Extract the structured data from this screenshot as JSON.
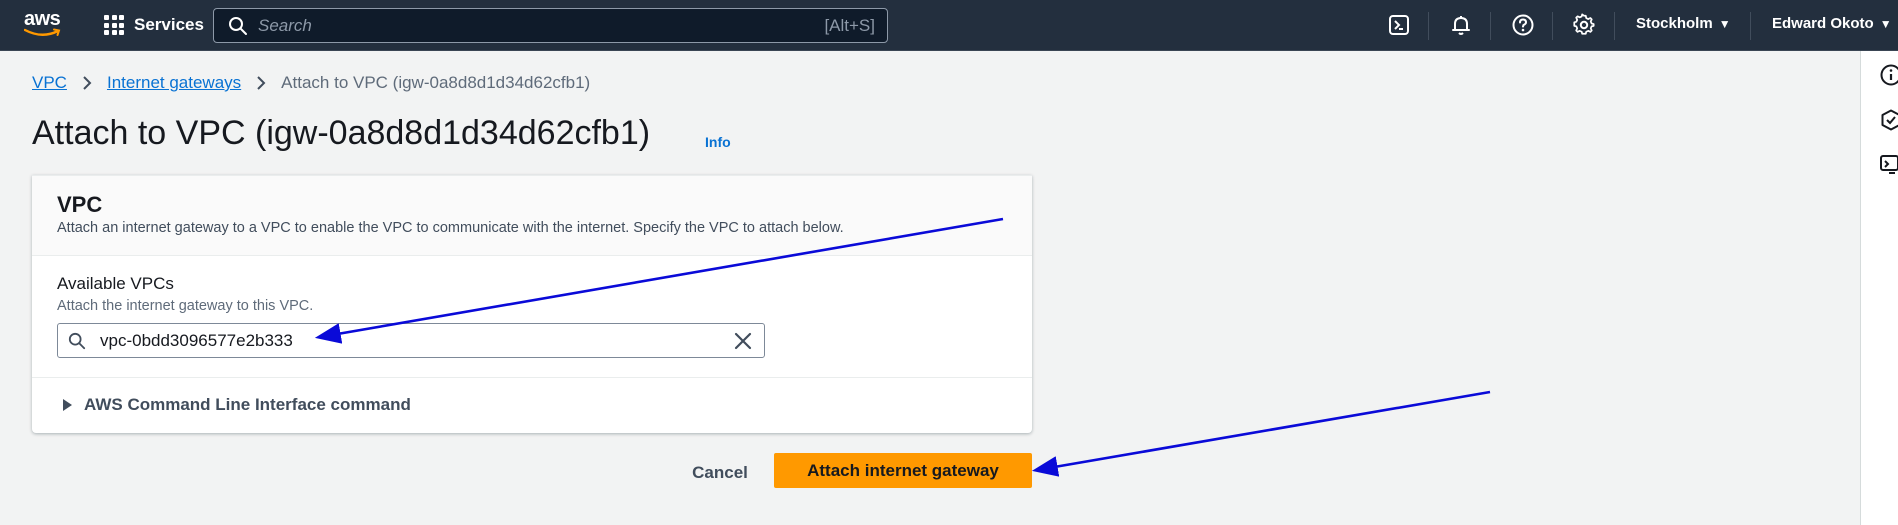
{
  "topnav": {
    "logo_text": "aws",
    "services_label": "Services",
    "search_placeholder": "Search",
    "search_shortcut": "[Alt+S]",
    "region": "Stockholm",
    "user": "Edward Okoto",
    "icons": [
      "cloudshell-icon",
      "bell-icon",
      "help-icon",
      "settings-icon"
    ]
  },
  "breadcrumb": {
    "items": [
      "VPC",
      "Internet gateways"
    ],
    "current": "Attach to VPC (igw-0a8d8d1d34d62cfb1)"
  },
  "page": {
    "title": "Attach to VPC (igw-0a8d8d1d34d62cfb1)",
    "info_label": "Info"
  },
  "card": {
    "title": "VPC",
    "description": "Attach an internet gateway to a VPC to enable the VPC to communicate with the internet. Specify the VPC to attach below.",
    "field_label": "Available VPCs",
    "field_description": "Attach the internet gateway to this VPC.",
    "selected_vpc": "vpc-0bdd3096577e2b333",
    "expander_label": "AWS Command Line Interface command"
  },
  "actions": {
    "cancel_label": "Cancel",
    "primary_label": "Attach internet gateway"
  },
  "colors": {
    "nav_bg": "#232f3e",
    "primary": "#ff9900",
    "link": "#0972d3",
    "annotation_arrow": "#0a0ad8"
  },
  "right_rail_icons": [
    "info-icon",
    "shield-icon",
    "feedback-icon"
  ]
}
